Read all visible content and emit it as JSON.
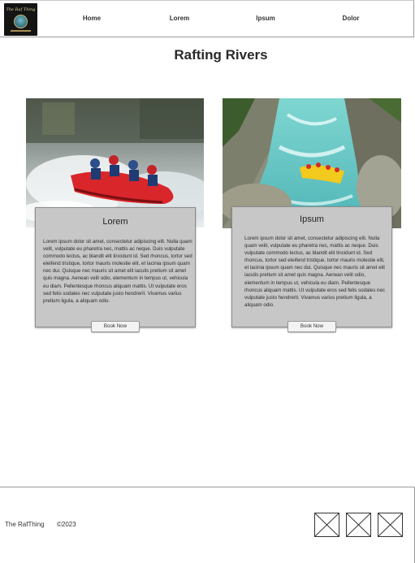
{
  "header": {
    "logo_text": "The Raf Thing",
    "nav": [
      "Home",
      "Lorem",
      "Ipsum",
      "Dolor"
    ]
  },
  "main": {
    "title": "Rafting Rivers",
    "cards": [
      {
        "title": "Lorem",
        "body": "Lorem ipsum dolor sit amet, consectetur adipiscing elit. Nulla quam velit, vulputate eu pharetra nec, mattis ac neque. Duis vulputate commodo lectus, ac blandit elit tincidunt id. Sed rhoncus, tortor sed eleifend tristique, tortor mauris molestie elit, et lacinia ipsum quam nec dui. Quisque nec mauris sit amet elit iaculis pretium sit amet quis magna. Aenean velit odio, elementum in tempus ut, vehicula eu diam. Pellentesque rhoncus aliquam mattis. Ut vulputate eros sed felis sodales nec vulputate justo hendrerit. Vivamus varius pretium ligula, a aliquam odio.",
        "button": "Book Now"
      },
      {
        "title": "Ipsum",
        "body": "Lorem ipsum dolor sit amet, consectetur adipiscing elit. Nulla quam velit, vulputate eu pharetra nec, mattis ac neque. Duis vulputate commodo lectus, ac blandit elit tincidunt id. Sed rhoncus, tortor sed eleifend tristique, tortor mauris molestie elit, et lacinia ipsum quam nec dui. Quisque nec mauris sit amet elit iaculis pretium sit amet quis magna. Aenean velit odio, elementum in tempus ut, vehicula eu diam. Pellentesque rhoncus aliquam mattis. Ut vulputate eros sed felis sodales nec vulputate justo hendrerit. Vivamus varius pretium ligula, a aliquam odio.",
        "button": "Book Now"
      }
    ]
  },
  "footer": {
    "brand": "The RafThing",
    "copyright": "©2023",
    "social_icons": [
      "image-placeholder-icon",
      "image-placeholder-icon",
      "image-placeholder-icon"
    ]
  },
  "colors": {
    "card_bg": "#c7c7c7",
    "button_bg": "#f3f3f3",
    "border": "#9a9a9a"
  }
}
